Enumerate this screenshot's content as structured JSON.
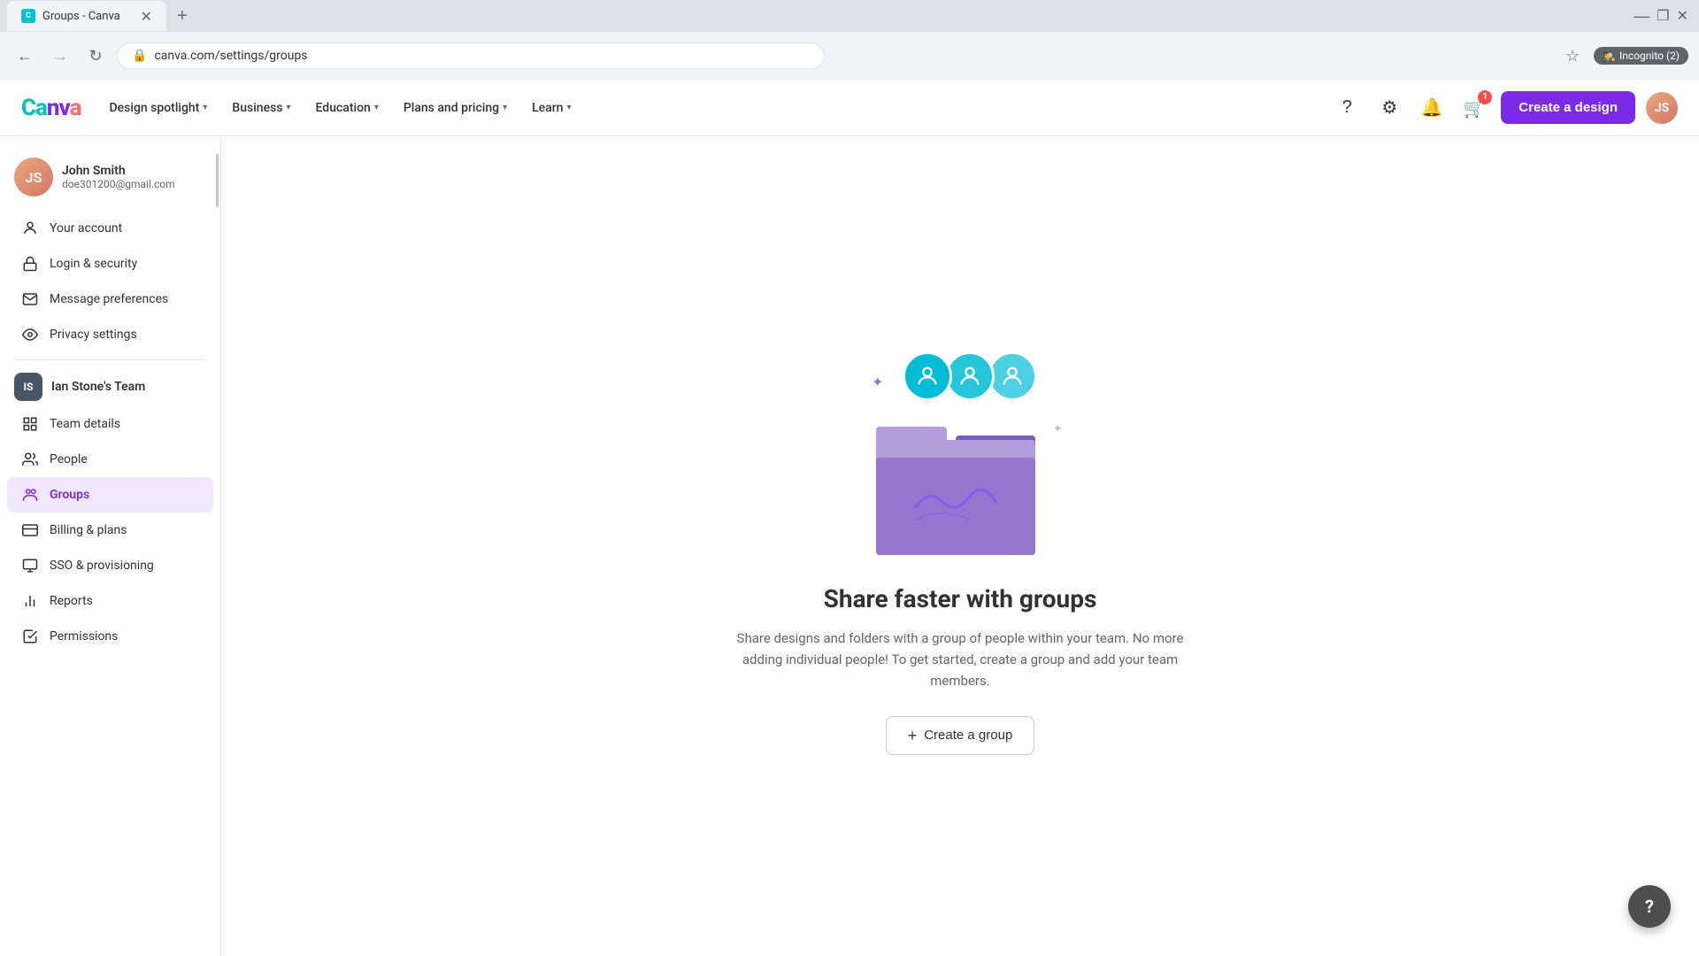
{
  "browser": {
    "tab_title": "Groups - Canva",
    "tab_favicon": "C",
    "url": "canva.com/settings/groups",
    "incognito_label": "Incognito (2)"
  },
  "nav": {
    "logo": "Canva",
    "items": [
      {
        "label": "Design spotlight",
        "has_chevron": true
      },
      {
        "label": "Business",
        "has_chevron": true
      },
      {
        "label": "Education",
        "has_chevron": true
      },
      {
        "label": "Plans and pricing",
        "has_chevron": true
      },
      {
        "label": "Learn",
        "has_chevron": true
      }
    ],
    "cart_count": "1",
    "create_design_label": "Create a design"
  },
  "sidebar": {
    "user": {
      "name": "John Smith",
      "email": "doe301200@gmail.com",
      "initials": "JS"
    },
    "account_items": [
      {
        "label": "Your account",
        "icon": "person-icon"
      },
      {
        "label": "Login & security",
        "icon": "lock-icon"
      },
      {
        "label": "Message preferences",
        "icon": "message-icon"
      },
      {
        "label": "Privacy settings",
        "icon": "eye-icon"
      }
    ],
    "team": {
      "name": "Ian Stone's Team",
      "initials": "IS"
    },
    "team_items": [
      {
        "label": "Team details",
        "icon": "grid-icon"
      },
      {
        "label": "People",
        "icon": "people-icon"
      },
      {
        "label": "Groups",
        "icon": "groups-icon",
        "active": true
      },
      {
        "label": "Billing & plans",
        "icon": "billing-icon"
      },
      {
        "label": "SSO & provisioning",
        "icon": "sso-icon"
      },
      {
        "label": "Reports",
        "icon": "reports-icon"
      },
      {
        "label": "Permissions",
        "icon": "permissions-icon"
      }
    ]
  },
  "main": {
    "title": "Share faster with groups",
    "description": "Share designs and folders with a group of people within your team. No more adding individual people! To get started, create a group and add your team members.",
    "create_group_label": "Create a group"
  },
  "help": {
    "label": "?"
  }
}
